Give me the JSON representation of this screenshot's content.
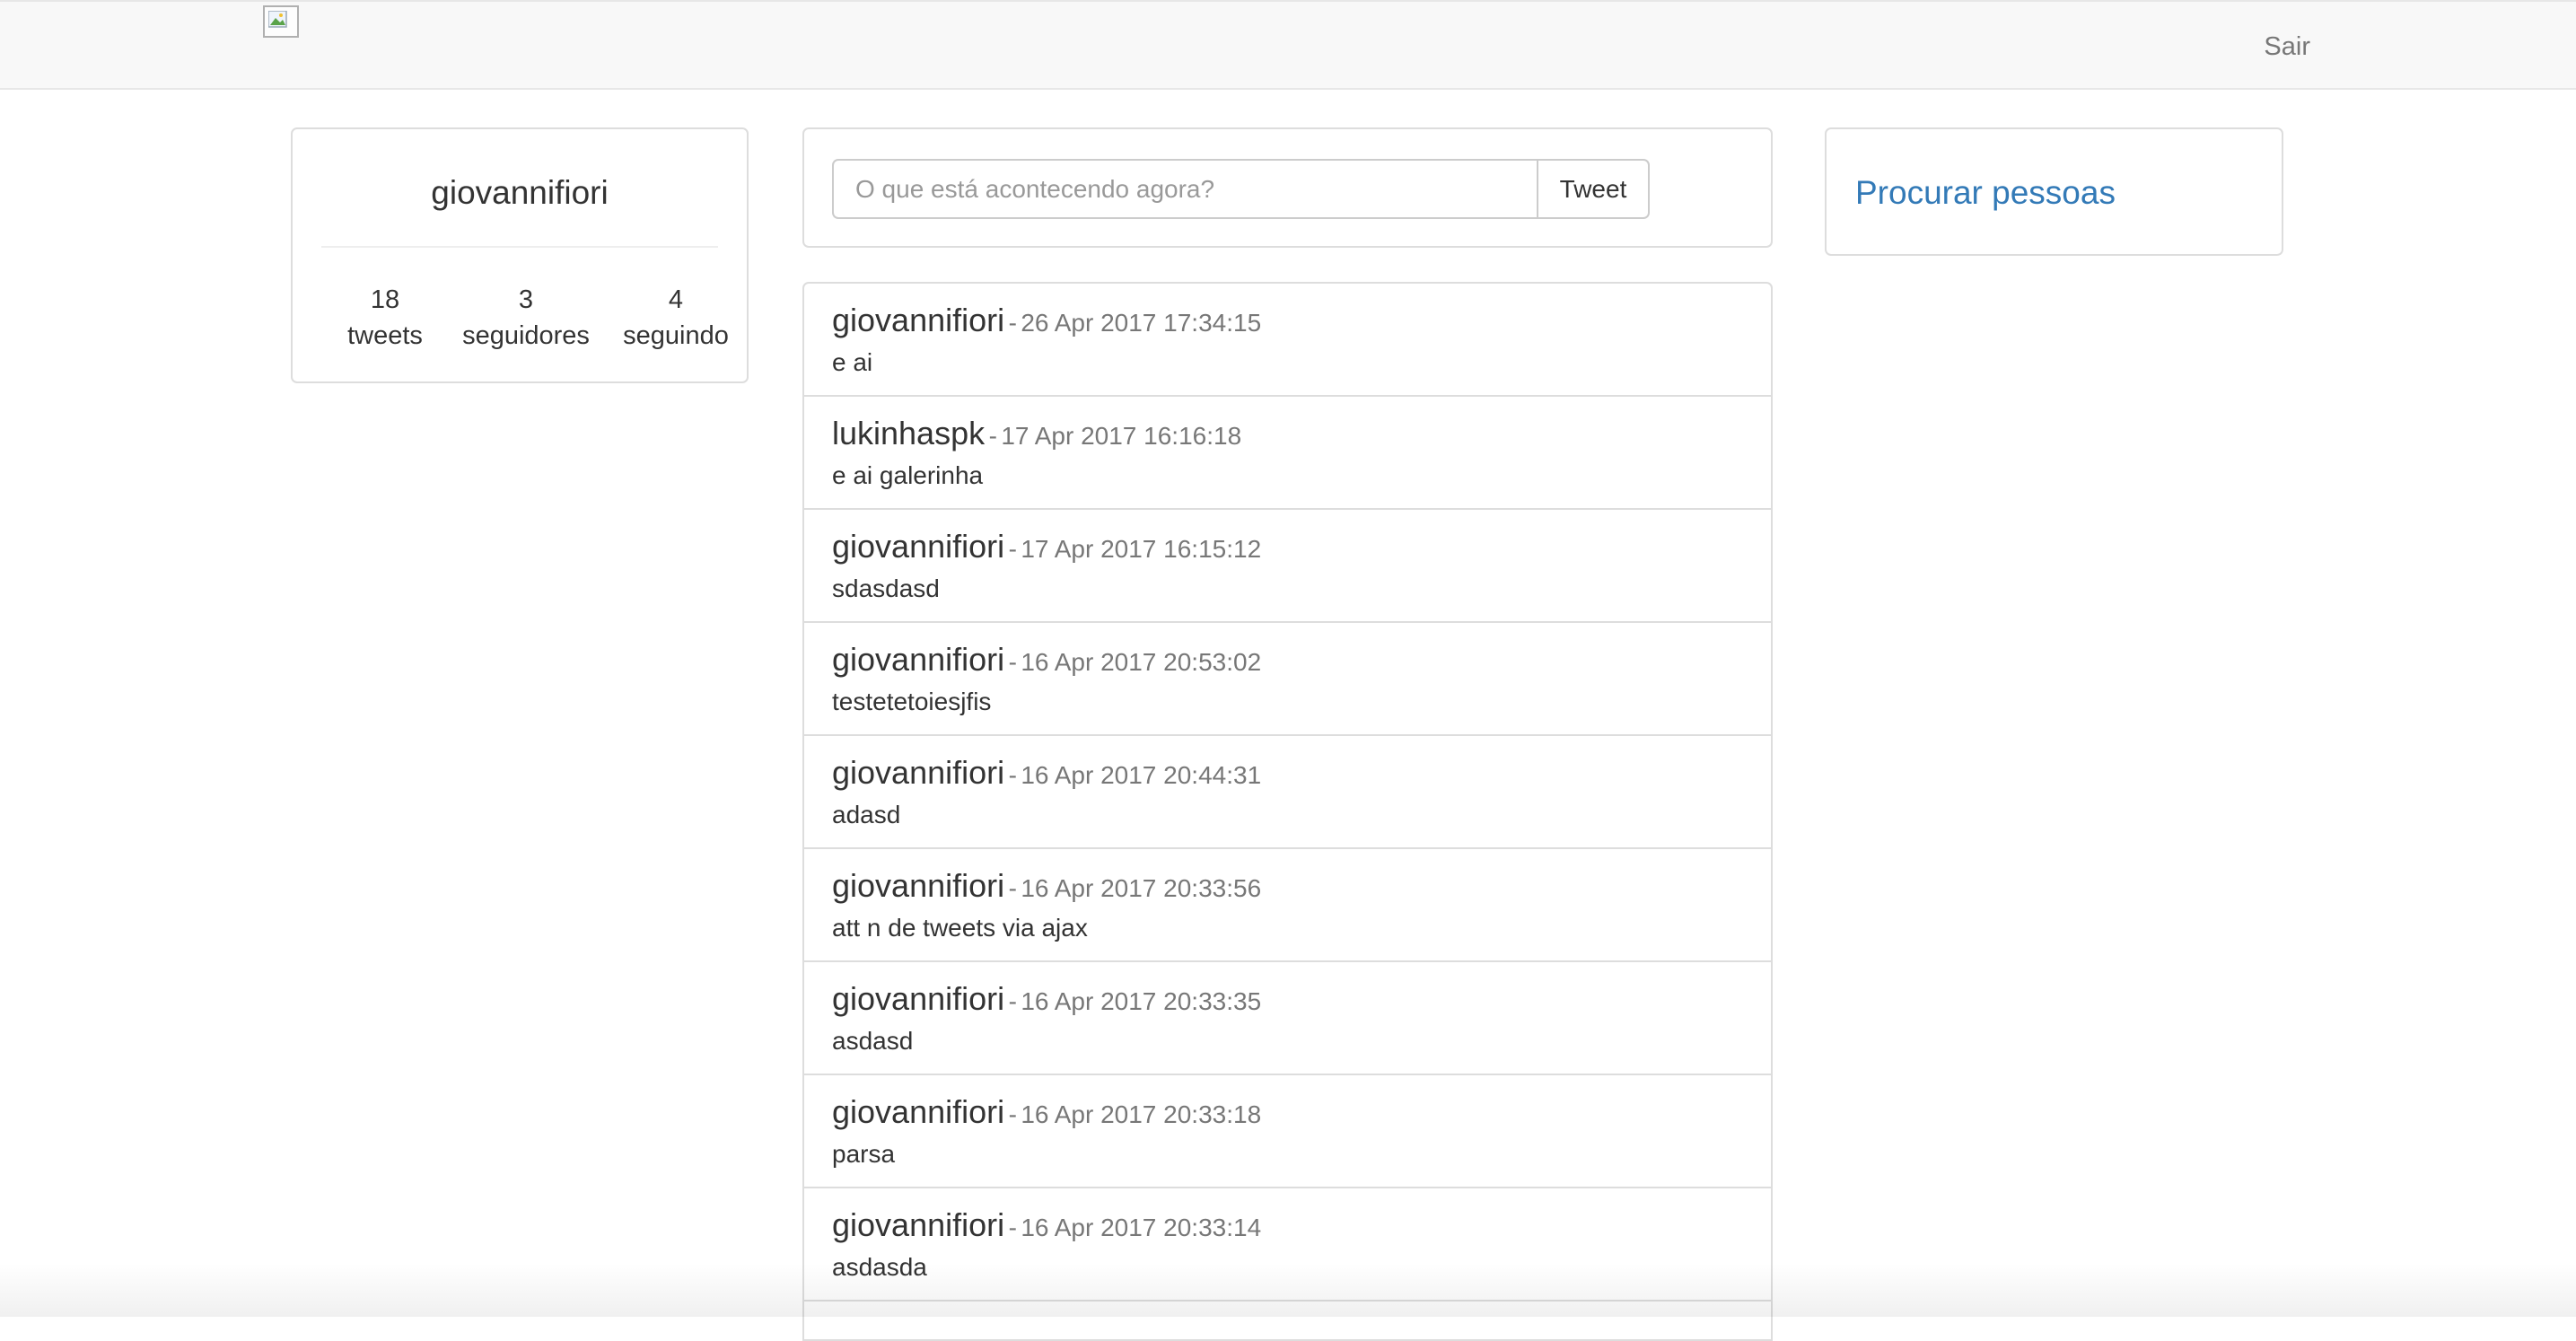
{
  "nav": {
    "logout_label": "Sair"
  },
  "profile": {
    "username": "giovannifiori",
    "stats": [
      {
        "value": "18",
        "label": "tweets"
      },
      {
        "value": "3",
        "label": "seguidores"
      },
      {
        "value": "4",
        "label": "seguindo"
      }
    ]
  },
  "composer": {
    "placeholder": "O que está acontecendo agora?",
    "button_label": "Tweet"
  },
  "separator": "-",
  "tweets": [
    {
      "user": "giovannifiori",
      "date": "26 Apr 2017 17:34:15",
      "text": "e ai"
    },
    {
      "user": "lukinhaspk",
      "date": "17 Apr 2017 16:16:18",
      "text": "e ai galerinha"
    },
    {
      "user": "giovannifiori",
      "date": "17 Apr 2017 16:15:12",
      "text": "sdasdasd"
    },
    {
      "user": "giovannifiori",
      "date": "16 Apr 2017 20:53:02",
      "text": "testetetoiesjfis"
    },
    {
      "user": "giovannifiori",
      "date": "16 Apr 2017 20:44:31",
      "text": "adasd"
    },
    {
      "user": "giovannifiori",
      "date": "16 Apr 2017 20:33:56",
      "text": "att n de tweets via ajax"
    },
    {
      "user": "giovannifiori",
      "date": "16 Apr 2017 20:33:35",
      "text": "asdasd"
    },
    {
      "user": "giovannifiori",
      "date": "16 Apr 2017 20:33:18",
      "text": "parsa"
    },
    {
      "user": "giovannifiori",
      "date": "16 Apr 2017 20:33:14",
      "text": "asdasda"
    }
  ],
  "sidebar": {
    "search_people_label": "Procurar pessoas"
  },
  "colors": {
    "link": "#337ab7",
    "muted": "#777777",
    "border": "#dddddd",
    "navbar": "#f8f8f8"
  },
  "icons": {
    "logo": "broken-image-icon"
  }
}
